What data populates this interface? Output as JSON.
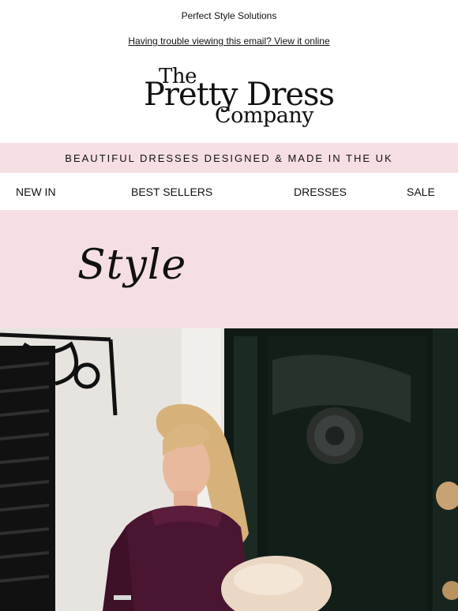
{
  "preheader": {
    "text": "Perfect Style Solutions"
  },
  "view_online": {
    "text": "Having trouble viewing this email? View it online"
  },
  "logo": {
    "line1": "The",
    "line2": "Pretty Dress",
    "line3": "Company"
  },
  "banner": {
    "text": "BEAUTIFUL DRESSES DESIGNED & MADE IN THE UK"
  },
  "nav": [
    {
      "label": "NEW IN"
    },
    {
      "label": "BEST SELLERS"
    },
    {
      "label": "DRESSES"
    },
    {
      "label": "SALE"
    }
  ],
  "hero": {
    "heading": "Style"
  },
  "colors": {
    "pink_band": "#f6dfe2",
    "door_green": "#0f1a14",
    "dress_plum": "#4a1530"
  }
}
